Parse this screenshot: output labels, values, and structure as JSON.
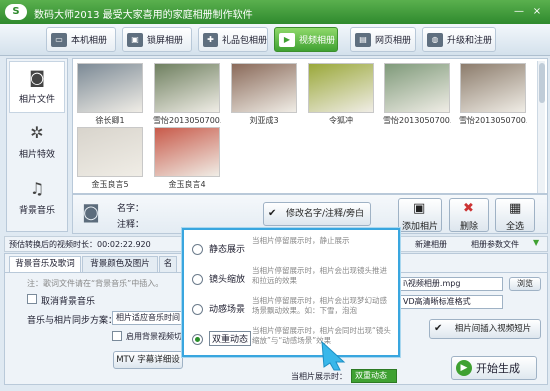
{
  "window": {
    "title_text": "数码大师2013    最受大家喜用的家庭相册制作软件",
    "logo_text": "S",
    "minimize": "—",
    "close": "×"
  },
  "tabs": [
    {
      "label": "本机相册",
      "icon": "computer-icon"
    },
    {
      "label": "锁屏相册",
      "icon": "monitor-icon"
    },
    {
      "label": "礼品包相册",
      "icon": "gift-icon"
    },
    {
      "label": "视频相册",
      "icon": "film-icon",
      "active": true
    },
    {
      "label": "网页相册",
      "icon": "webpage-icon"
    },
    {
      "label": "升级和注册",
      "icon": "globe-icon"
    }
  ],
  "leftnav": [
    {
      "label": "相片文件",
      "icon": "camera-icon",
      "glyph": "◙",
      "active": true
    },
    {
      "label": "相片特效",
      "icon": "sparkle-icon",
      "glyph": "✲"
    },
    {
      "label": "背景音乐",
      "icon": "music-note-icon",
      "glyph": "♫"
    }
  ],
  "photos": [
    {
      "caption": "徐长卿1",
      "color": "#7c8a96"
    },
    {
      "caption": "雪怡2013050700...",
      "color": "#6f8060"
    },
    {
      "caption": "刘亚成3",
      "color": "#8a6a5a"
    },
    {
      "caption": "令狐冲",
      "color": "#9aa83a"
    },
    {
      "caption": "雪怡2013050700...",
      "color": "#7f9a7a"
    },
    {
      "caption": "雪怡2013050700...",
      "color": "#8c7c6c"
    },
    {
      "caption": "金玉良言5",
      "color": "#d8d4cc"
    },
    {
      "caption": "金玉良言4",
      "color": "#c85a4a"
    }
  ],
  "editbar": {
    "name_label": "名字：",
    "note_label": "注释：",
    "edit_button": "修改名字/注释/旁白",
    "add_button": "添加相片",
    "delete_button": "删除",
    "select_all_button": "全选"
  },
  "statusbar": {
    "duration_text": "预估转换后的视频时长：00:02:22.920",
    "new_album": "新建相册",
    "params_file": "相册参数文件"
  },
  "bottom_tabs": [
    "背景音乐及歌词",
    "背景颜色及图片",
    "名"
  ],
  "bottom": {
    "note": "注：歌词文件请在“背景音乐”中插入。",
    "cancel_music": "取消背景音乐",
    "sync_label": "音乐与相片同步方案：",
    "sync_value": "相片适应音乐时间",
    "enable_lyrics": "启用背景视频切",
    "mtv_button": "MTV 字幕详细设",
    "output_path": "i\\视频相册.mpg",
    "browse": "浏览",
    "format_value": "VD高清晰标准格式",
    "insert_clip": "相片间插入视频短片",
    "show_label": "当相片展示时：",
    "show_value": "双重动态",
    "generate": "开始生成"
  },
  "popup_options": [
    {
      "name": "静态展示",
      "desc": "当相片停留展示时，静止展示"
    },
    {
      "name": "镜头缩放",
      "desc": "当相片停留展示时，相片会出现镜头推进和拉远的效果"
    },
    {
      "name": "动感场景",
      "desc": "当相片停留展示时，相片会出现梦幻动感场景飘动效果。如：下雪，泡泡"
    },
    {
      "name": "双重动态",
      "desc": "当相片停留展示时，相片会同时出现“镜头缩放”与“动感场景”效果",
      "selected": true
    }
  ],
  "colors": {
    "accent_green": "#3fa132",
    "popup_border": "#39a6df"
  }
}
